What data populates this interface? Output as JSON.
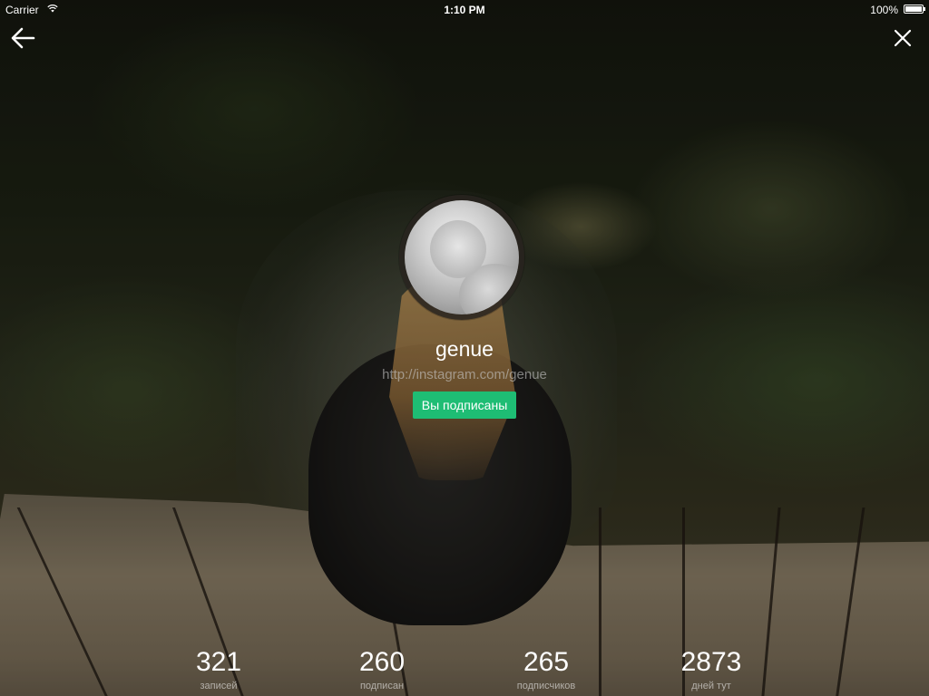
{
  "status_bar": {
    "carrier": "Carrier",
    "time": "1:10 PM",
    "battery": "100%"
  },
  "profile": {
    "username": "genue",
    "url": "http://instagram.com/genue",
    "follow_state_label": "Вы подписаны"
  },
  "stats": [
    {
      "value": "321",
      "label": "записей"
    },
    {
      "value": "260",
      "label": "подписан"
    },
    {
      "value": "265",
      "label": "подписчиков"
    },
    {
      "value": "2873",
      "label": "дней тут"
    }
  ],
  "colors": {
    "follow_button": "#1ebd74",
    "text": "#ffffff"
  },
  "icons": {
    "back": "arrow-left",
    "close": "x",
    "wifi": "wifi",
    "battery": "battery-full"
  }
}
